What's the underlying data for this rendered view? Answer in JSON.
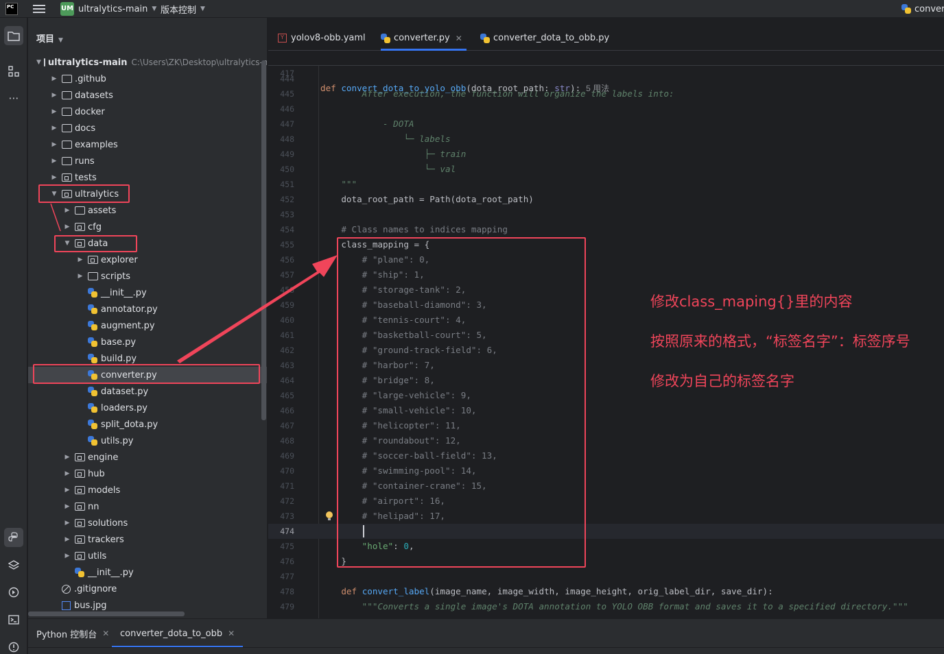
{
  "titlebar": {
    "logo_text": "PC",
    "project_badge": "UM",
    "project_name": "ultralytics-main",
    "vcs_label": "版本控制",
    "run_config": "conver"
  },
  "panel": {
    "title": "项目",
    "tree": [
      {
        "label": "ultralytics-main",
        "hint": "C:\\Users\\ZK\\Desktop\\ultralytics-m",
        "type": "root",
        "expanded": true
      },
      {
        "label": ".github",
        "type": "folder"
      },
      {
        "label": "datasets",
        "type": "folder"
      },
      {
        "label": "docker",
        "type": "folder"
      },
      {
        "label": "docs",
        "type": "folder"
      },
      {
        "label": "examples",
        "type": "folder"
      },
      {
        "label": "runs",
        "type": "folder"
      },
      {
        "label": "tests",
        "type": "package"
      },
      {
        "label": "ultralytics",
        "type": "package",
        "expanded": true
      },
      {
        "label": "assets",
        "type": "folder"
      },
      {
        "label": "cfg",
        "type": "package"
      },
      {
        "label": "data",
        "type": "package",
        "expanded": true
      },
      {
        "label": "explorer",
        "type": "package"
      },
      {
        "label": "scripts",
        "type": "folder"
      },
      {
        "label": "__init__.py",
        "type": "python"
      },
      {
        "label": "annotator.py",
        "type": "python"
      },
      {
        "label": "augment.py",
        "type": "python"
      },
      {
        "label": "base.py",
        "type": "python"
      },
      {
        "label": "build.py",
        "type": "python"
      },
      {
        "label": "converter.py",
        "type": "python",
        "selected": true
      },
      {
        "label": "dataset.py",
        "type": "python"
      },
      {
        "label": "loaders.py",
        "type": "python"
      },
      {
        "label": "split_dota.py",
        "type": "python"
      },
      {
        "label": "utils.py",
        "type": "python"
      },
      {
        "label": "engine",
        "type": "package"
      },
      {
        "label": "hub",
        "type": "package"
      },
      {
        "label": "models",
        "type": "package"
      },
      {
        "label": "nn",
        "type": "package"
      },
      {
        "label": "solutions",
        "type": "package"
      },
      {
        "label": "trackers",
        "type": "package"
      },
      {
        "label": "utils",
        "type": "package"
      },
      {
        "label": "__init__.py",
        "type": "python"
      },
      {
        "label": ".gitignore",
        "type": "ignore"
      },
      {
        "label": "bus.jpg",
        "type": "image"
      }
    ]
  },
  "tabs": [
    {
      "label": "yolov8-obb.yaml",
      "icon": "yaml-icon"
    },
    {
      "label": "converter.py",
      "icon": "python-icon",
      "active": true
    },
    {
      "label": "converter_dota_to_obb.py",
      "icon": "python-icon"
    }
  ],
  "editor": {
    "sticky_line": "417",
    "sticky_usages": "5 用法",
    "current_line": "474",
    "lines": {
      "444": "",
      "445": "After execution, the function will organize the labels into:",
      "446": "",
      "447": "- DOTA",
      "448": "└─ labels",
      "449": "├─ train",
      "450": "└─ val",
      "451": "\"\"\"",
      "452": "dota_root_path = Path(dota_root_path)",
      "453": "",
      "454": "# Class names to indices mapping",
      "455": "class_mapping = {"
    },
    "mapping_comments": [
      "# \"plane\": 0,",
      "# \"ship\": 1,",
      "# \"storage-tank\": 2,",
      "# \"baseball-diamond\": 3,",
      "# \"tennis-court\": 4,",
      "# \"basketball-court\": 5,",
      "# \"ground-track-field\": 6,",
      "# \"harbor\": 7,",
      "# \"bridge\": 8,",
      "# \"large-vehicle\": 9,",
      "# \"small-vehicle\": 10,",
      "# \"helicopter\": 11,",
      "# \"roundabout\": 12,",
      "# \"soccer-ball-field\": 13,",
      "# \"swimming-pool\": 14,",
      "# \"container-crane\": 15,",
      "# \"airport\": 16,",
      "# \"helipad\": 17,"
    ],
    "new_entry_key": "\"hole\"",
    "new_entry_value": "0",
    "closing_brace": "}",
    "def2_name": "convert_label",
    "def2_params": "(image_name, image_width, image_height, orig_label_dir, save_dir):",
    "docstring2": "\"\"\"Converts a single image's DOTA annotation to YOLO OBB format and saves it to a specified directory.\"\"\""
  },
  "annotations": {
    "line1": "修改class_maping{}里的内容",
    "line2": "按照原来的格式，“标签名字”：标签序号",
    "line3": "修改为自己的标签名字",
    "color": "#f0455a"
  },
  "bottom": {
    "tab1": "Python 控制台",
    "tab2": "converter_dota_to_obb"
  },
  "colors": {
    "accent": "#3574f0",
    "keyword": "#cf8e6d",
    "function": "#56a8f5",
    "string": "#6aab73",
    "number": "#2aacb8",
    "comment": "#7a7e85",
    "docstring": "#5f826b"
  }
}
